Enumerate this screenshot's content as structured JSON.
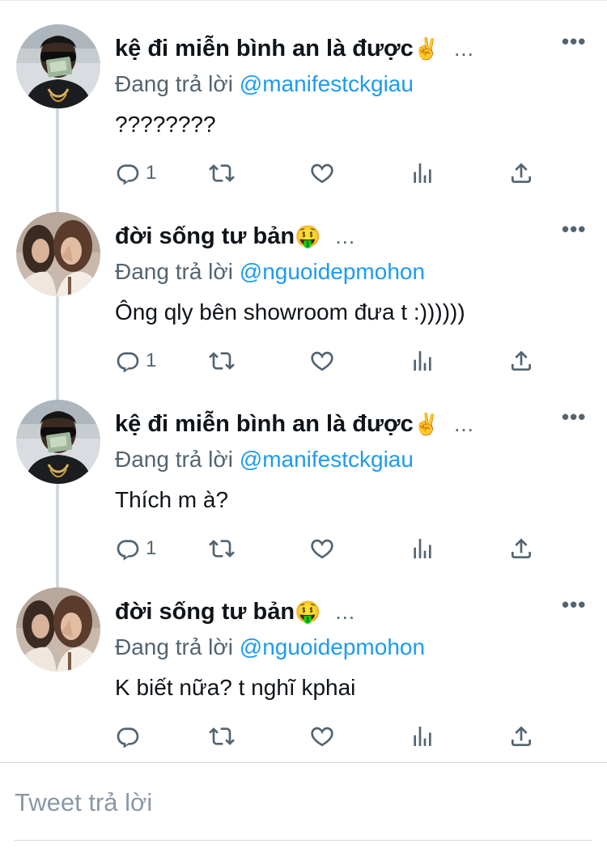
{
  "colors": {
    "accent": "#1d9bf0",
    "secondary_text": "#536471",
    "thread_line": "#cfd9de"
  },
  "tweets": [
    {
      "author_name": "kệ đi miễn bình an là được",
      "author_emoji": "✌️",
      "truncation": "...",
      "reply_prefix": "Đang trả lời",
      "reply_to": "@manifestckgiau",
      "text": "????????",
      "reply_count": "1",
      "avatar_icon": "avatar-sunglasses-money"
    },
    {
      "author_name": "đời sống tư bản",
      "author_emoji": "🤑",
      "truncation": "...",
      "reply_prefix": "Đang trả lời",
      "reply_to": "@nguoidepmohon",
      "text": "Ông qly bên showroom đưa t :))))))",
      "reply_count": "1",
      "avatar_icon": "avatar-two-girls"
    },
    {
      "author_name": "kệ đi miễn bình an là được",
      "author_emoji": "✌️",
      "truncation": "...",
      "reply_prefix": "Đang trả lời",
      "reply_to": "@manifestckgiau",
      "text": "Thích m à?",
      "reply_count": "1",
      "avatar_icon": "avatar-sunglasses-money"
    },
    {
      "author_name": "đời sống tư bản",
      "author_emoji": "🤑",
      "truncation": "...",
      "reply_prefix": "Đang trả lời",
      "reply_to": "@nguoidepmohon",
      "text": "K biết nữa? t nghĩ kphai",
      "reply_count": "",
      "avatar_icon": "avatar-two-girls"
    }
  ],
  "more_label": "•••",
  "composer": {
    "placeholder": "Tweet trả lời"
  },
  "icons": [
    "reply-icon",
    "retweet-icon",
    "like-icon",
    "stats-icon",
    "share-icon",
    "more-icon"
  ]
}
